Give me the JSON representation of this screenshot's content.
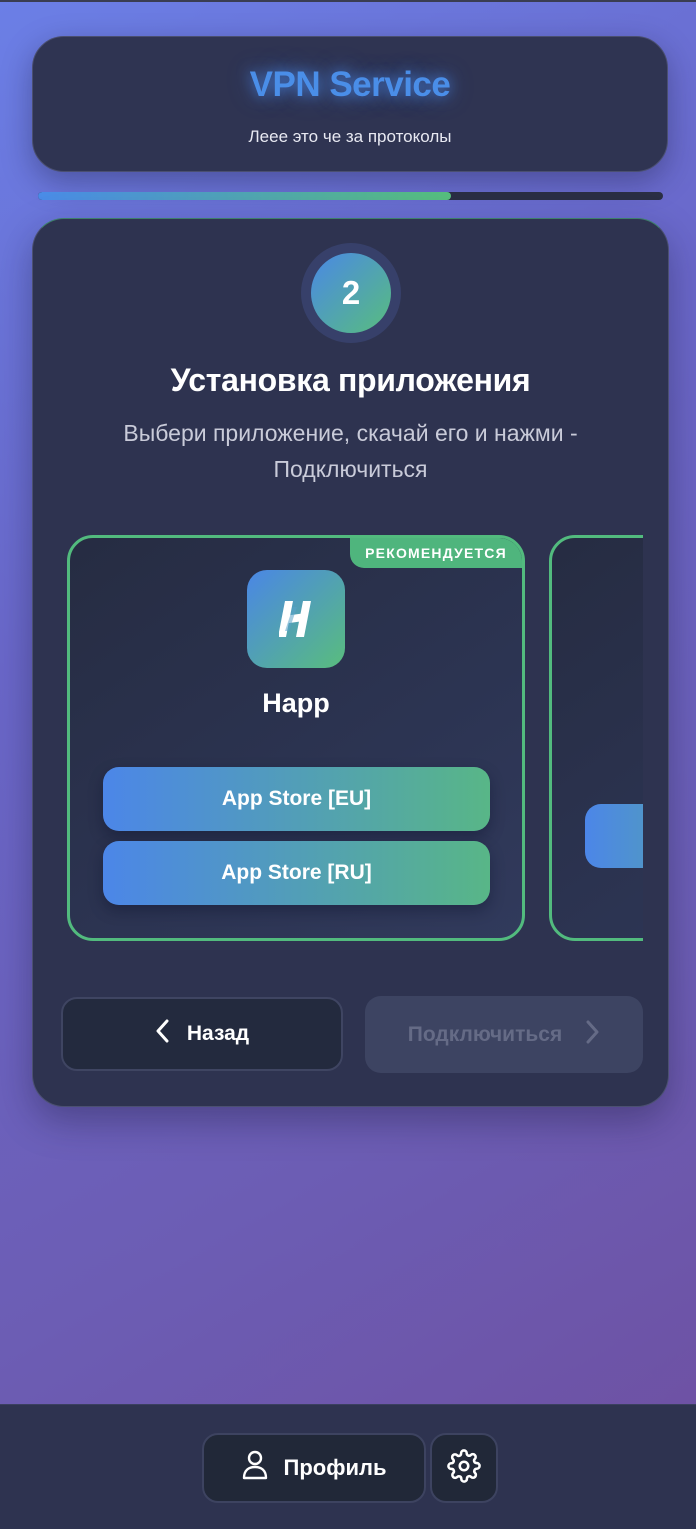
{
  "header": {
    "title": "VPN Service",
    "subtitle": "Леее это че за протоколы"
  },
  "progress": {
    "percent": 66
  },
  "step": {
    "number": "2",
    "title": "Установка приложения",
    "description": "Выбери приложение, скачай его и нажми - Подключиться"
  },
  "apps": [
    {
      "name": "Happ",
      "badge": "РЕКОМЕНДУЕТСЯ",
      "icon": "happ-logo-icon",
      "buttons": [
        {
          "label": "App Store [EU]"
        },
        {
          "label": "App Store [RU]"
        }
      ]
    }
  ],
  "nav": {
    "back_label": "Назад",
    "connect_label": "Подключиться"
  },
  "bottom": {
    "profile_label": "Профиль",
    "settings_icon": "gear-icon"
  },
  "colors": {
    "accent_blue": "#4a8be8",
    "accent_green": "#56be7d",
    "card_bg": "#2e3350"
  }
}
